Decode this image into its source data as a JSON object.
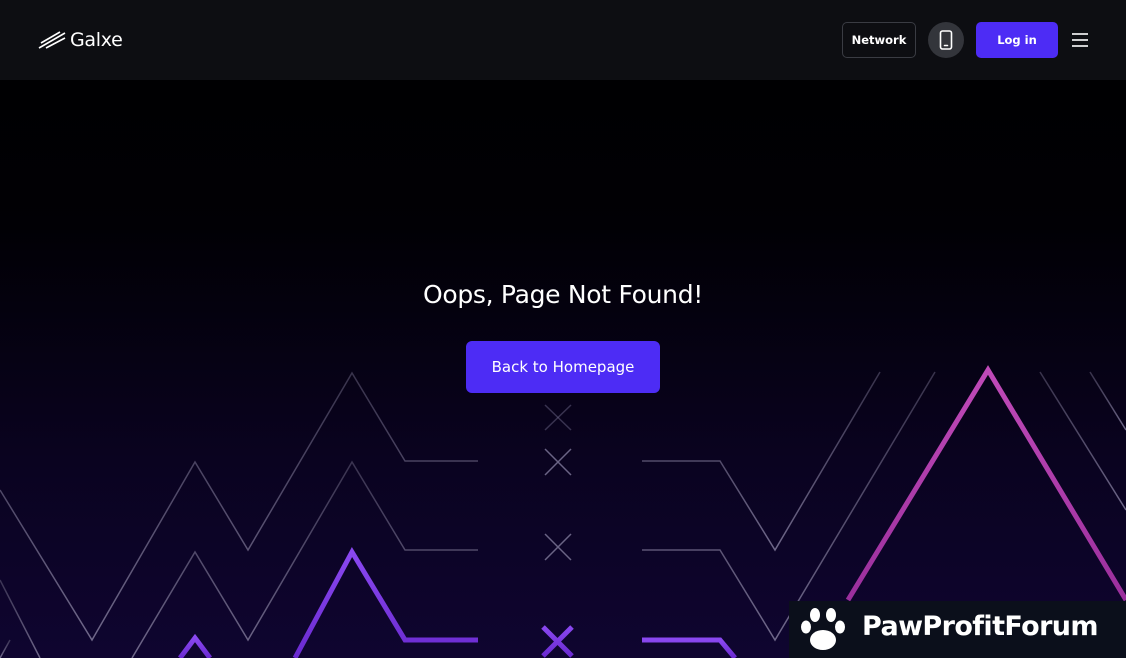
{
  "header": {
    "logo_text": "Galxe",
    "network_label": "Network",
    "login_label": "Log in",
    "mobile_icon": "smartphone-icon",
    "menu_icon": "hamburger-menu-icon"
  },
  "main": {
    "title": "Oops, Page Not Found!",
    "home_button_label": "Back to Homepage"
  },
  "watermark": {
    "text": "PawProfitForum",
    "icon": "paw-icon"
  },
  "colors": {
    "accent": "#4d2cf5",
    "header_bg": "#0d0e12",
    "pink_line": "#b04ab3",
    "purple_line": "#7b3de0"
  }
}
